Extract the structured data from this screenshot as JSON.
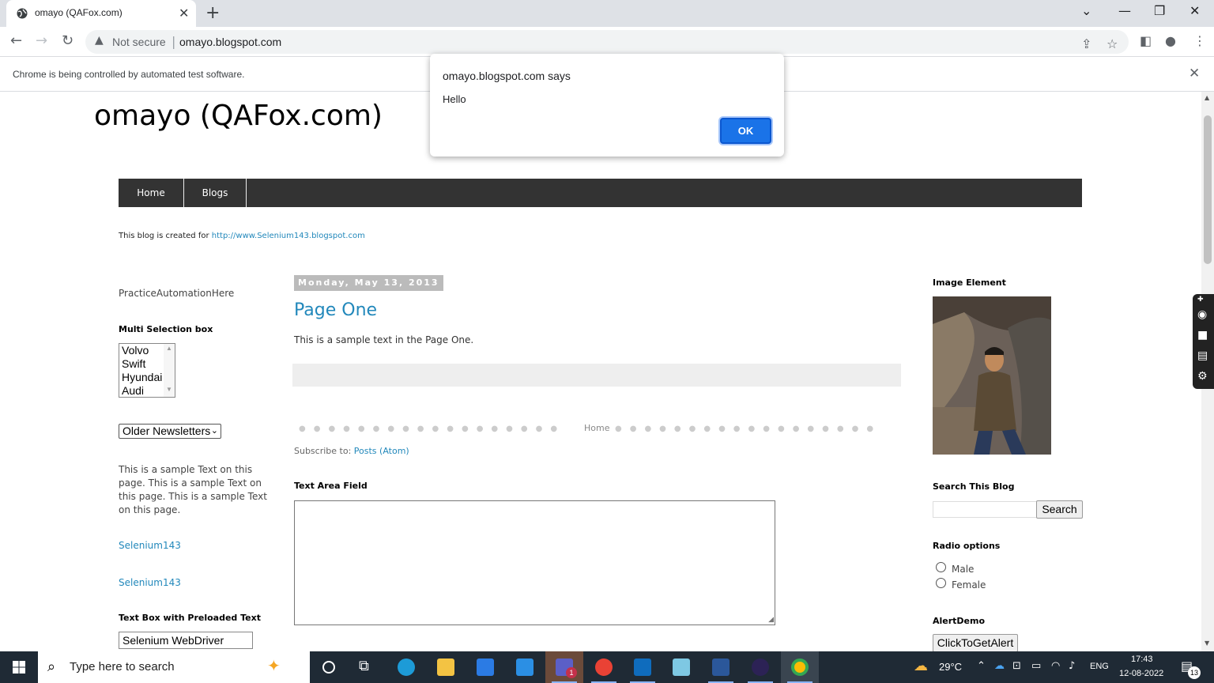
{
  "browser": {
    "tab_title": "omayo (QAFox.com)",
    "not_secure": "Not secure",
    "url": "omayo.blogspot.com",
    "infobar_text": "Chrome is being controlled by automated test software."
  },
  "page": {
    "blog_title": "omayo (QAFox.com)",
    "nav": [
      "Home",
      "Blogs"
    ],
    "description_prefix": "This blog is created for",
    "description_link": "http://www.Selenium143.blogspot.com",
    "left": {
      "practice_text": "PracticeAutomationHere",
      "multi_select_heading": "Multi Selection box",
      "multi_select_options": [
        "Volvo",
        "Swift",
        "Hyundai",
        "Audi"
      ],
      "older_newsletters": "Older Newsletters",
      "sample_text_lines": [
        "This is a sample Text on this",
        "page. This is a sample Text on",
        "this page. This is a sample Text",
        "on this page."
      ],
      "link1": "Selenium143",
      "link2": "Selenium143",
      "preloaded_heading": "Text Box with Preloaded Text",
      "preloaded_value": "Selenium WebDriver"
    },
    "main": {
      "date_header": "Monday, May 13, 2013",
      "post_title": "Page One",
      "post_body": "This is a sample text in the Page One.",
      "pager_home": "Home",
      "subscribe_label": "Subscribe to:",
      "subscribe_link": "Posts (Atom)",
      "textarea_heading": "Text Area Field"
    },
    "right": {
      "image_heading": "Image Element",
      "search_heading": "Search This Blog",
      "search_button": "Search",
      "radio_heading": "Radio options",
      "radio_male": "Male",
      "radio_female": "Female",
      "alert_heading": "AlertDemo",
      "alert_button": "ClickToGetAlert"
    }
  },
  "dialog": {
    "title": "omayo.blogspot.com says",
    "message": "Hello",
    "ok": "OK"
  },
  "taskbar": {
    "search_placeholder": "Type here to search",
    "temperature": "29°C",
    "language": "ENG",
    "time": "17:43",
    "date": "12-08-2022",
    "notification_count": "13",
    "teams_badge": "1"
  },
  "colors": {
    "link": "#2288bb",
    "navbar": "#333333",
    "dialog_button": "#1a73e8",
    "taskbar": "#1f2a35"
  }
}
